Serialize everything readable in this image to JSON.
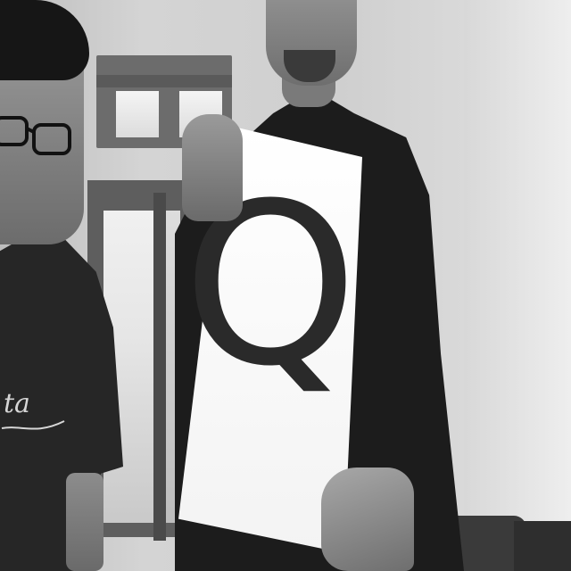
{
  "photo": {
    "sign_letter": "Q",
    "shirt_print": "ta",
    "tone": "grayscale"
  }
}
